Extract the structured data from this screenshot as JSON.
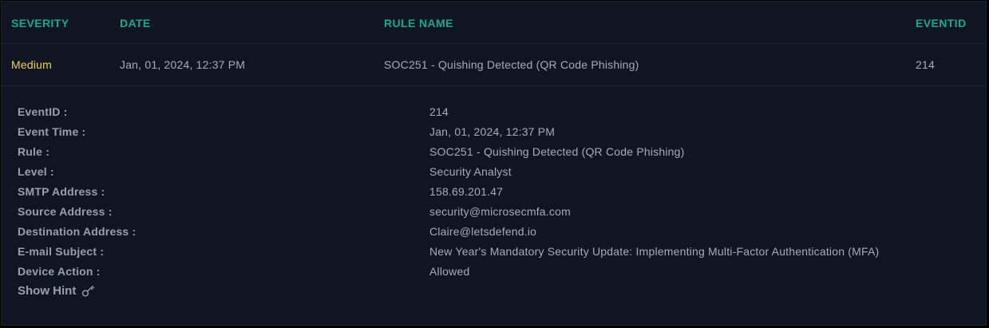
{
  "columns": {
    "severity": "SEVERITY",
    "date": "DATE",
    "rule_name": "RULE NAME",
    "event_id": "EVENTID"
  },
  "row": {
    "severity": "Medium",
    "date": "Jan, 01, 2024, 12:37 PM",
    "rule_name": "SOC251 - Quishing Detected (QR Code Phishing)",
    "event_id": "214"
  },
  "details": [
    {
      "label": "EventID :",
      "value": "214"
    },
    {
      "label": "Event Time :",
      "value": "Jan, 01, 2024, 12:37 PM"
    },
    {
      "label": "Rule :",
      "value": "SOC251 - Quishing Detected (QR Code Phishing)"
    },
    {
      "label": "Level :",
      "value": "Security Analyst"
    },
    {
      "label": "SMTP Address :",
      "value": "158.69.201.47"
    },
    {
      "label": "Source Address :",
      "value": "security@microsecmfa.com"
    },
    {
      "label": "Destination Address :",
      "value": "Claire@letsdefend.io"
    },
    {
      "label": "E-mail Subject :",
      "value": "New Year's Mandatory Security Update: Implementing Multi-Factor Authentication (MFA)"
    },
    {
      "label": "Device Action :",
      "value": "Allowed"
    }
  ],
  "hint": {
    "label": "Show Hint",
    "icon": "key-icon"
  },
  "colors": {
    "accent": "#17a98f",
    "severity_medium": "#f2d24a",
    "background": "#0f1622"
  }
}
